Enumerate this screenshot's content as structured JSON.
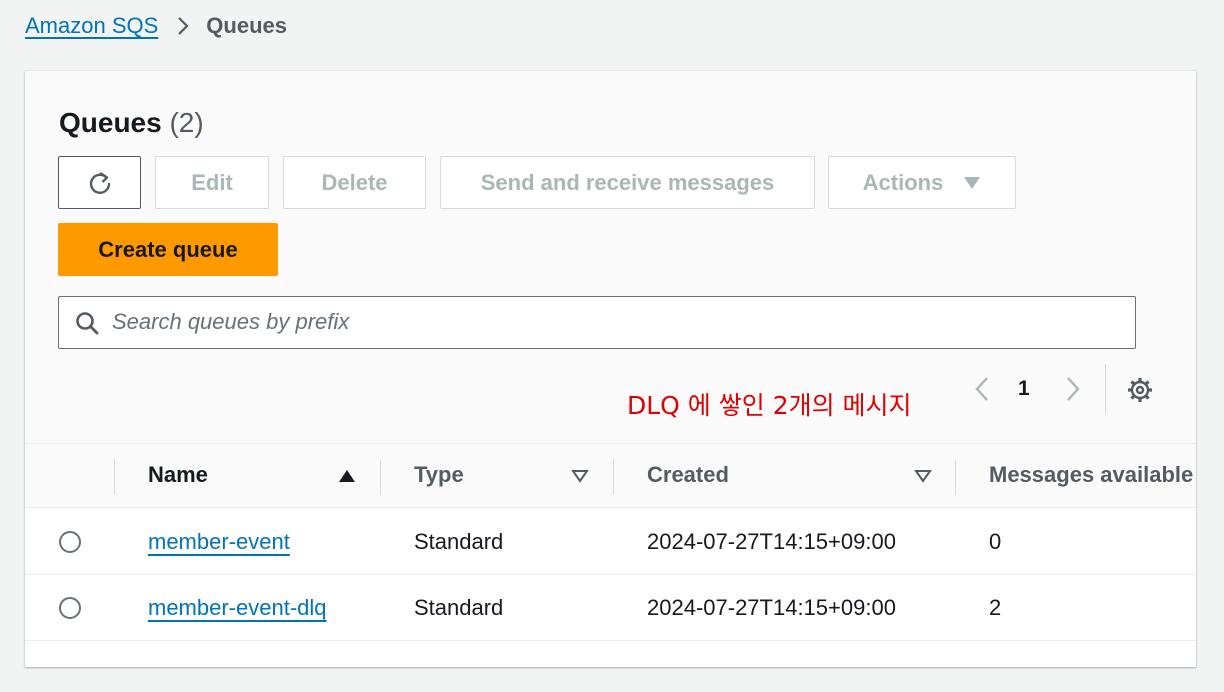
{
  "breadcrumb": {
    "root": "Amazon SQS",
    "current": "Queues"
  },
  "panel": {
    "title": "Queues",
    "count": "(2)"
  },
  "toolbar": {
    "edit_label": "Edit",
    "delete_label": "Delete",
    "send_label": "Send and receive messages",
    "actions_label": "Actions",
    "create_label": "Create queue"
  },
  "search": {
    "placeholder": "Search queues by prefix",
    "value": ""
  },
  "annotation": "DLQ 에 쌓인 2개의 메시지",
  "pagination": {
    "current_page": "1"
  },
  "table": {
    "columns": [
      "Name",
      "Type",
      "Created",
      "Messages available"
    ],
    "rows": [
      {
        "name": "member-event",
        "type": "Standard",
        "created": "2024-07-27T14:15+09:00",
        "messages": "0"
      },
      {
        "name": "member-event-dlq",
        "type": "Standard",
        "created": "2024-07-27T14:15+09:00",
        "messages": "2"
      }
    ]
  },
  "colors": {
    "link": "#0073bb",
    "primary": "#ff9900",
    "annotation": "#e00000",
    "disabled_text": "#aab7b8"
  },
  "icons": [
    "chevron-right-icon",
    "refresh-icon",
    "caret-down-icon",
    "search-icon",
    "chevron-left-icon",
    "gear-icon",
    "sort-ascending-icon",
    "sort-descending-icon"
  ]
}
